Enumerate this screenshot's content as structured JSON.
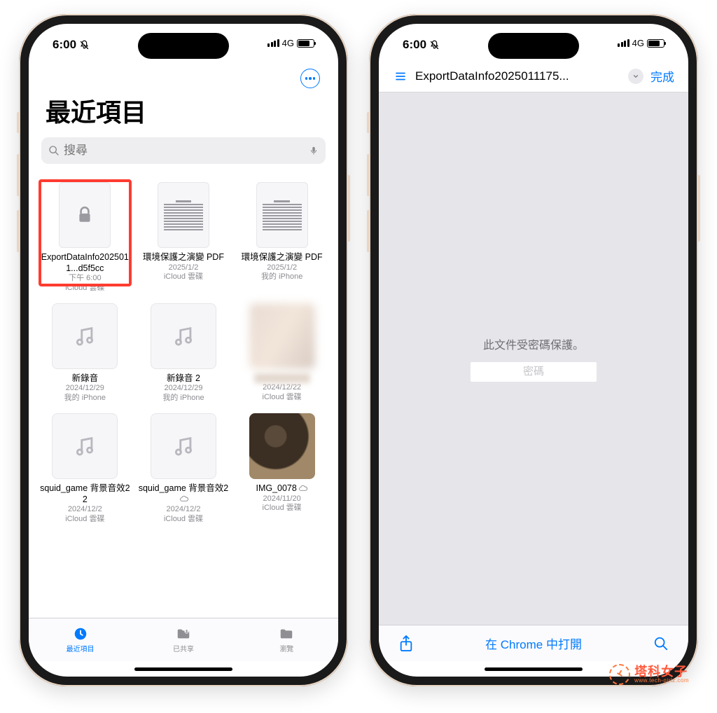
{
  "status": {
    "time": "6:00",
    "cell": "4G",
    "silent_icon": "bell-off-icon"
  },
  "left_phone": {
    "header": {
      "more_label": "更多",
      "title": "最近項目"
    },
    "search": {
      "placeholder": "搜尋"
    },
    "files": [
      {
        "name": "ExportDataInfo2025011...d5f5cc",
        "meta": "下午 6:00",
        "loc": "iCloud 雲碟",
        "kind": "locked",
        "highlighted": true,
        "cloud": false
      },
      {
        "name": "環境保護之演變 PDF",
        "meta": "2025/1/2",
        "loc": "iCloud 雲碟",
        "kind": "doc",
        "highlighted": false,
        "cloud": false
      },
      {
        "name": "環境保護之演變 PDF",
        "meta": "2025/1/2",
        "loc": "我的 iPhone",
        "kind": "doc",
        "highlighted": false,
        "cloud": false
      },
      {
        "name": "新錄音",
        "meta": "2024/12/29",
        "loc": "我的 iPhone",
        "kind": "audio",
        "highlighted": false,
        "cloud": false
      },
      {
        "name": "新錄音 2",
        "meta": "2024/12/29",
        "loc": "我的 iPhone",
        "kind": "audio",
        "highlighted": false,
        "cloud": false
      },
      {
        "name": "",
        "meta": "2024/12/22",
        "loc": "iCloud 雲碟",
        "kind": "blur",
        "highlighted": false,
        "cloud": false
      },
      {
        "name": "squid_game 背景音效2 2",
        "meta": "2024/12/2",
        "loc": "iCloud 雲碟",
        "kind": "audio",
        "highlighted": false,
        "cloud": false
      },
      {
        "name": "squid_game 背景音效2",
        "meta": "2024/12/2",
        "loc": "iCloud 雲碟",
        "kind": "audio",
        "highlighted": false,
        "cloud": true
      },
      {
        "name": "IMG_0078",
        "meta": "2024/11/20",
        "loc": "iCloud 雲碟",
        "kind": "cat",
        "highlighted": false,
        "cloud": true
      }
    ],
    "tabs": [
      {
        "id": "recent",
        "label": "最近項目",
        "active": true
      },
      {
        "id": "shared",
        "label": "已共享",
        "active": false
      },
      {
        "id": "browse",
        "label": "瀏覽",
        "active": false
      }
    ]
  },
  "right_phone": {
    "nav": {
      "title": "ExportDataInfo2025011175...",
      "done_label": "完成"
    },
    "protect_msg": "此文件受密碼保護。",
    "password_placeholder": "密碼",
    "bottom": {
      "open_in_chrome": "在 Chrome 中打開"
    }
  },
  "watermark": {
    "cn": "塔科女子",
    "en": "www.tech-girlz.com"
  }
}
